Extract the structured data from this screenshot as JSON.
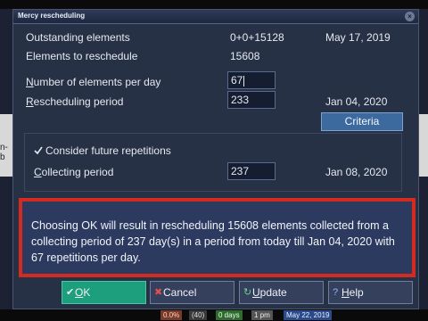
{
  "window": {
    "title": "Mercy rescheduling"
  },
  "background": {
    "fragment": "n-b"
  },
  "rows": {
    "outstanding": {
      "label": "Outstanding elements",
      "value": "0+0+15128",
      "date": "May 17, 2019"
    },
    "to_reschedule": {
      "label": "Elements to reschedule",
      "value": "15608"
    },
    "per_day": {
      "label_first": "N",
      "label_rest": "umber of elements per day",
      "value": "67"
    },
    "period": {
      "label_first": "R",
      "label_rest": "escheduling period",
      "value": "233",
      "date": "Jan 04, 2020"
    },
    "future": {
      "label": "Consider future repetitions",
      "checked": true
    },
    "collecting": {
      "label_first": "C",
      "label_rest": "ollecting period",
      "value": "237",
      "date": "Jan 08, 2020"
    }
  },
  "criteria_button": "Criteria",
  "message": "Choosing OK will result in rescheduling 15608 elements collected from a collecting period of 237 day(s) in a period from today till Jan 04, 2020 with 67 repetitions per day.",
  "buttons": {
    "ok": {
      "first": "O",
      "rest": "K",
      "icon": "check-icon"
    },
    "cancel": {
      "first": "",
      "rest": "Cancel",
      "icon": "cross-icon"
    },
    "update": {
      "first": "U",
      "rest": "pdate",
      "icon": "refresh-icon"
    },
    "help": {
      "first": "H",
      "rest": "elp",
      "icon": "help-icon"
    }
  },
  "taskbar": {
    "items": [
      "0.0%",
      "(40)",
      "0 days",
      "1 pm",
      "May 22, 2019"
    ]
  },
  "colors": {
    "dialog_bg": "#263145",
    "highlight_frame": "#d42a20",
    "ok_button": "#1d9e7c",
    "criteria_button": "#3d6a9e"
  }
}
